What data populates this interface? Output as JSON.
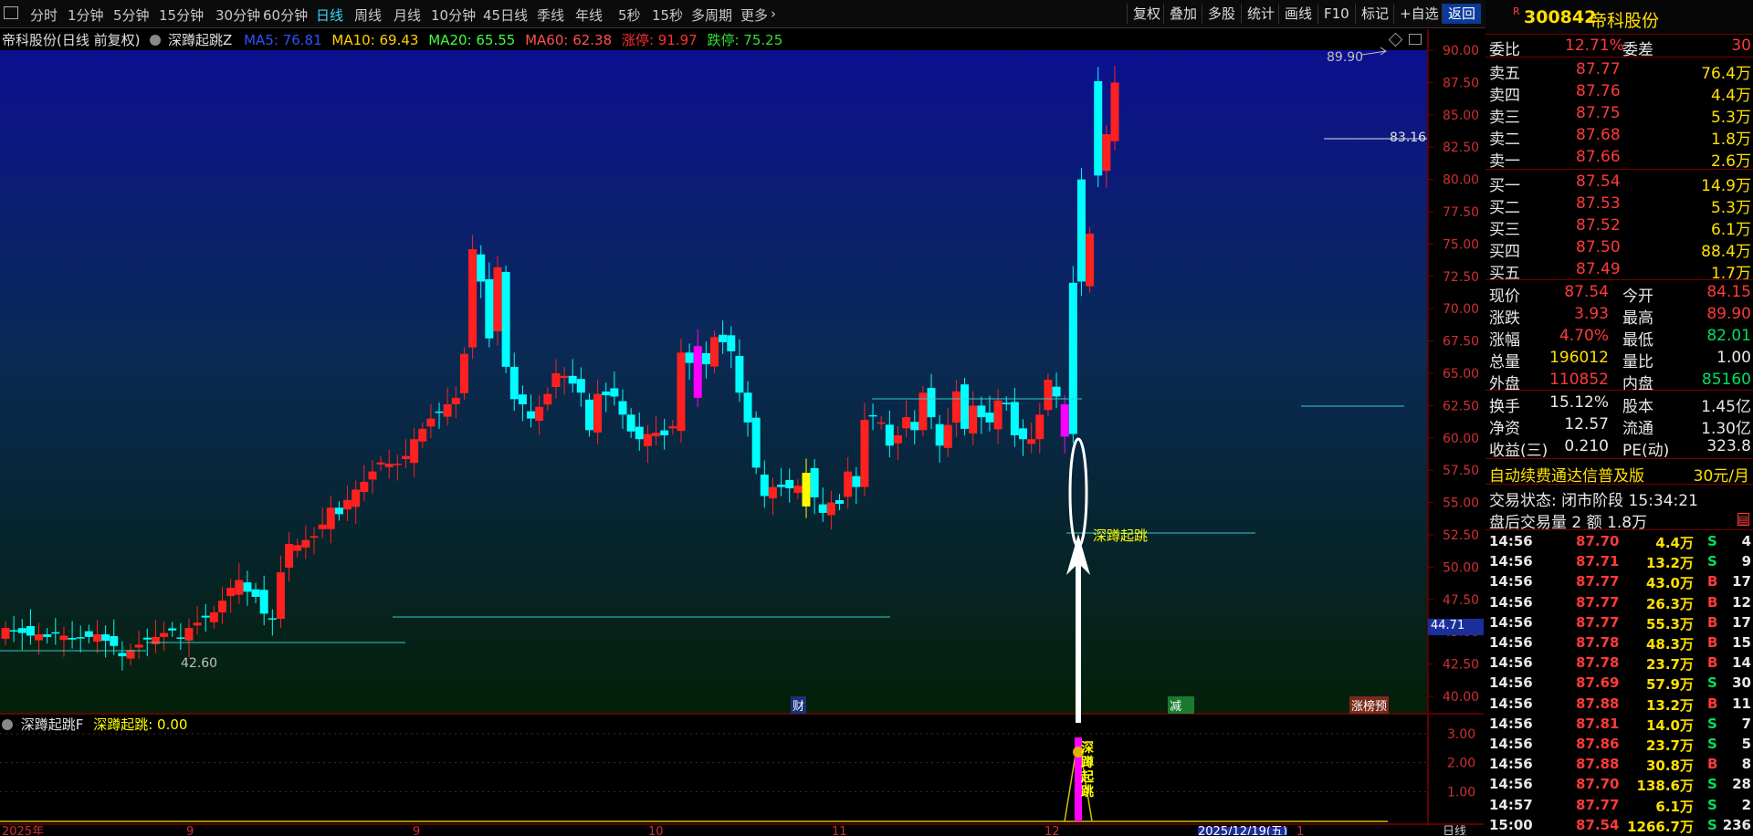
{
  "toolbar": {
    "tabs": [
      "分时",
      "1分钟",
      "5分钟",
      "15分钟",
      "30分钟",
      "60分钟",
      "日线",
      "周线",
      "月线",
      "10分钟",
      "45日线",
      "季线",
      "年线",
      "5秒",
      "15秒",
      "多周期",
      "更多"
    ],
    "active_tab": "日线",
    "right_buttons": [
      "复权",
      "叠加",
      "多股",
      "统计",
      "画线",
      "F10",
      "标记",
      "+自选",
      "返回"
    ]
  },
  "chart_header": {
    "stock_label": "帝科股份(日线 前复权)",
    "indicator_name": "深蹲起跳Z",
    "ma5": "MA5: 76.81",
    "ma10": "MA10: 69.43",
    "ma20": "MA20: 65.55",
    "ma60": "MA60: 62.38",
    "limit_up": "涨停: 91.97",
    "limit_down": "跌停: 75.25"
  },
  "price_axis": [
    "90.00",
    "87.50",
    "85.00",
    "82.50",
    "80.00",
    "77.50",
    "75.00",
    "72.50",
    "70.00",
    "67.50",
    "65.00",
    "62.50",
    "60.00",
    "57.50",
    "55.00",
    "52.50",
    "50.00",
    "47.50",
    "45.00",
    "42.50",
    "40.00"
  ],
  "price_marker": "44.71",
  "annotations": {
    "high_label": "89.90",
    "resistance_label": "83.16",
    "low_label": "42.60",
    "signal_label": "深蹲起跳",
    "badge_cai": "财",
    "badge_mie": "减",
    "badge_rank": "涨榜预"
  },
  "sub_chart": {
    "header_name": "深蹲起跳F",
    "header_value": "深蹲起跳: 0.00",
    "axis": [
      "3.00",
      "2.00",
      "1.00"
    ],
    "signal_chars": [
      "深",
      "蹲",
      "起",
      "跳"
    ]
  },
  "date_axis": {
    "labels": [
      "2025年",
      "9",
      "9",
      "10",
      "11",
      "12",
      "2025/12/19(五)",
      "1"
    ],
    "corner": "日线"
  },
  "quote": {
    "code": "300842",
    "name": "帝科股份",
    "weibi_label": "委比",
    "weibi_value": "12.71%",
    "weicha_label": "委差",
    "weicha_value": "30",
    "asks": [
      {
        "label": "卖五",
        "price": "87.77",
        "vol": "76.4万"
      },
      {
        "label": "卖四",
        "price": "87.76",
        "vol": "4.4万"
      },
      {
        "label": "卖三",
        "price": "87.75",
        "vol": "5.3万"
      },
      {
        "label": "卖二",
        "price": "87.68",
        "vol": "1.8万"
      },
      {
        "label": "卖一",
        "price": "87.66",
        "vol": "2.6万"
      }
    ],
    "bids": [
      {
        "label": "买一",
        "price": "87.54",
        "vol": "14.9万"
      },
      {
        "label": "买二",
        "price": "87.53",
        "vol": "5.3万"
      },
      {
        "label": "买三",
        "price": "87.52",
        "vol": "6.1万"
      },
      {
        "label": "买四",
        "price": "87.50",
        "vol": "88.4万"
      },
      {
        "label": "买五",
        "price": "87.49",
        "vol": "1.7万"
      }
    ],
    "stats1": [
      {
        "l1": "现价",
        "v1": "87.54",
        "l2": "今开",
        "v2": "84.15"
      },
      {
        "l1": "涨跌",
        "v1": "3.93",
        "l2": "最高",
        "v2": "89.90"
      },
      {
        "l1": "涨幅",
        "v1": "4.70%",
        "l2": "最低",
        "v2": "82.01"
      },
      {
        "l1": "总量",
        "v1": "196012",
        "l2": "量比",
        "v2": "1.00"
      },
      {
        "l1": "外盘",
        "v1": "110852",
        "l2": "内盘",
        "v2": "85160"
      }
    ],
    "stats2": [
      {
        "l1": "换手",
        "v1": "15.12%",
        "l2": "股本",
        "v2": "1.45亿"
      },
      {
        "l1": "净资",
        "v1": "12.57",
        "l2": "流通",
        "v2": "1.30亿"
      },
      {
        "l1": "收益(三)",
        "v1": "0.210",
        "l2": "PE(动)",
        "v2": "323.8"
      }
    ],
    "promo": "自动续费通达信普及版",
    "promo_price": "30元/月",
    "trade_state": "交易状态: 闭市阶段 15:34:21",
    "after_hours": "盘后交易量 2 额 1.8万",
    "ticks": [
      {
        "t": "14:56",
        "p": "87.70",
        "v": "4.4万",
        "s": "S",
        "n": "4"
      },
      {
        "t": "14:56",
        "p": "87.71",
        "v": "13.2万",
        "s": "S",
        "n": "9"
      },
      {
        "t": "14:56",
        "p": "87.77",
        "v": "43.0万",
        "s": "B",
        "n": "17"
      },
      {
        "t": "14:56",
        "p": "87.77",
        "v": "26.3万",
        "s": "B",
        "n": "12"
      },
      {
        "t": "14:56",
        "p": "87.77",
        "v": "55.3万",
        "s": "B",
        "n": "17"
      },
      {
        "t": "14:56",
        "p": "87.78",
        "v": "48.3万",
        "s": "B",
        "n": "15"
      },
      {
        "t": "14:56",
        "p": "87.78",
        "v": "23.7万",
        "s": "B",
        "n": "14"
      },
      {
        "t": "14:56",
        "p": "87.69",
        "v": "57.9万",
        "s": "S",
        "n": "30"
      },
      {
        "t": "14:56",
        "p": "87.88",
        "v": "13.2万",
        "s": "B",
        "n": "11"
      },
      {
        "t": "14:56",
        "p": "87.81",
        "v": "14.0万",
        "s": "S",
        "n": "7"
      },
      {
        "t": "14:56",
        "p": "87.86",
        "v": "23.7万",
        "s": "S",
        "n": "5"
      },
      {
        "t": "14:56",
        "p": "87.88",
        "v": "30.8万",
        "s": "B",
        "n": "8"
      },
      {
        "t": "14:56",
        "p": "87.70",
        "v": "138.6万",
        "s": "S",
        "n": "28"
      },
      {
        "t": "14:57",
        "p": "87.77",
        "v": "6.1万",
        "s": "S",
        "n": "2"
      },
      {
        "t": "15:00",
        "p": "87.54",
        "v": "1266.7万",
        "s": "S",
        "n": "236"
      }
    ]
  },
  "colors": {
    "up": "#ff2020",
    "down": "#00ffff",
    "signal_yellow": "#ffff00",
    "magenta": "#ff00ff",
    "level_line": "#33cccc"
  }
}
